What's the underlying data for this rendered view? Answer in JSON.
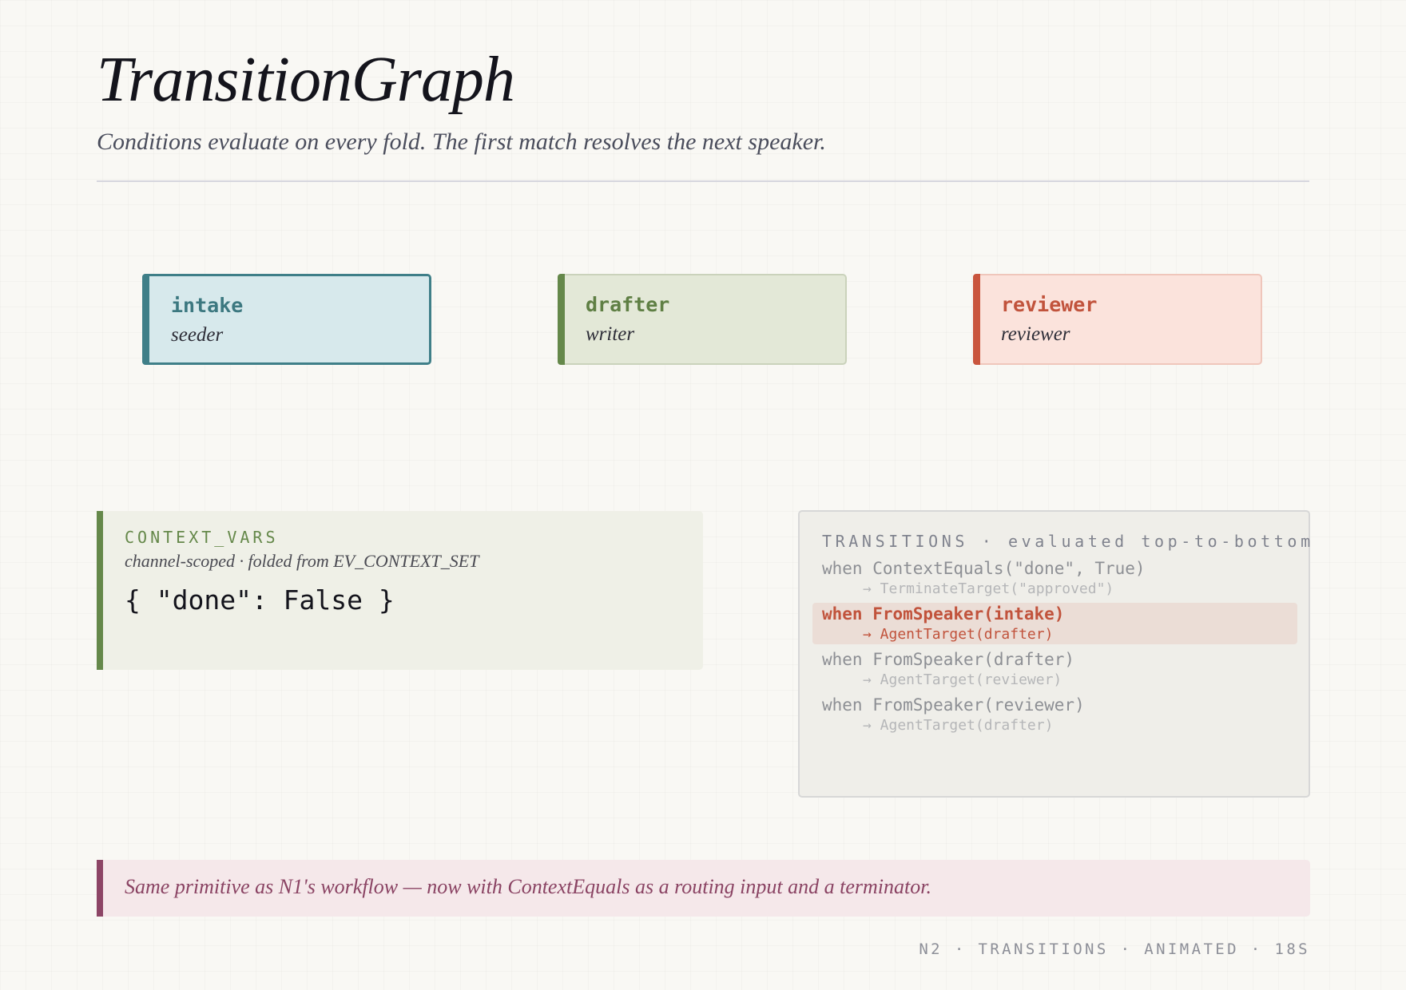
{
  "header": {
    "title": "TransitionGraph",
    "subtitle": "Conditions evaluate on every fold. The first match resolves the next speaker."
  },
  "nodes": [
    {
      "name": "intake",
      "role": "seeder",
      "color": "#3f7f88",
      "active": true
    },
    {
      "name": "drafter",
      "role": "writer",
      "color": "#65884a",
      "active": false
    },
    {
      "name": "reviewer",
      "role": "reviewer",
      "color": "#c9553d",
      "active": false
    }
  ],
  "context_vars": {
    "label": "CONTEXT_VARS",
    "subtitle": "channel-scoped · folded from EV_CONTEXT_SET",
    "value": "{ \"done\": False }"
  },
  "transitions": {
    "header": "TRANSITIONS · evaluated top-to-bottom",
    "rules": [
      {
        "when": "when ContextEquals(\"done\", True)",
        "target": "→ TerminateTarget(\"approved\")",
        "active": false
      },
      {
        "when": "when FromSpeaker(intake)",
        "target": "→ AgentTarget(drafter)",
        "active": true
      },
      {
        "when": "when FromSpeaker(drafter)",
        "target": "→ AgentTarget(reviewer)",
        "active": false
      },
      {
        "when": "when FromSpeaker(reviewer)",
        "target": "→ AgentTarget(drafter)",
        "active": false
      }
    ]
  },
  "note": "Same primitive as N1's workflow — now with ContextEquals as a routing input and a terminator.",
  "footer": "N2 · TRANSITIONS · ANIMATED · 18S"
}
